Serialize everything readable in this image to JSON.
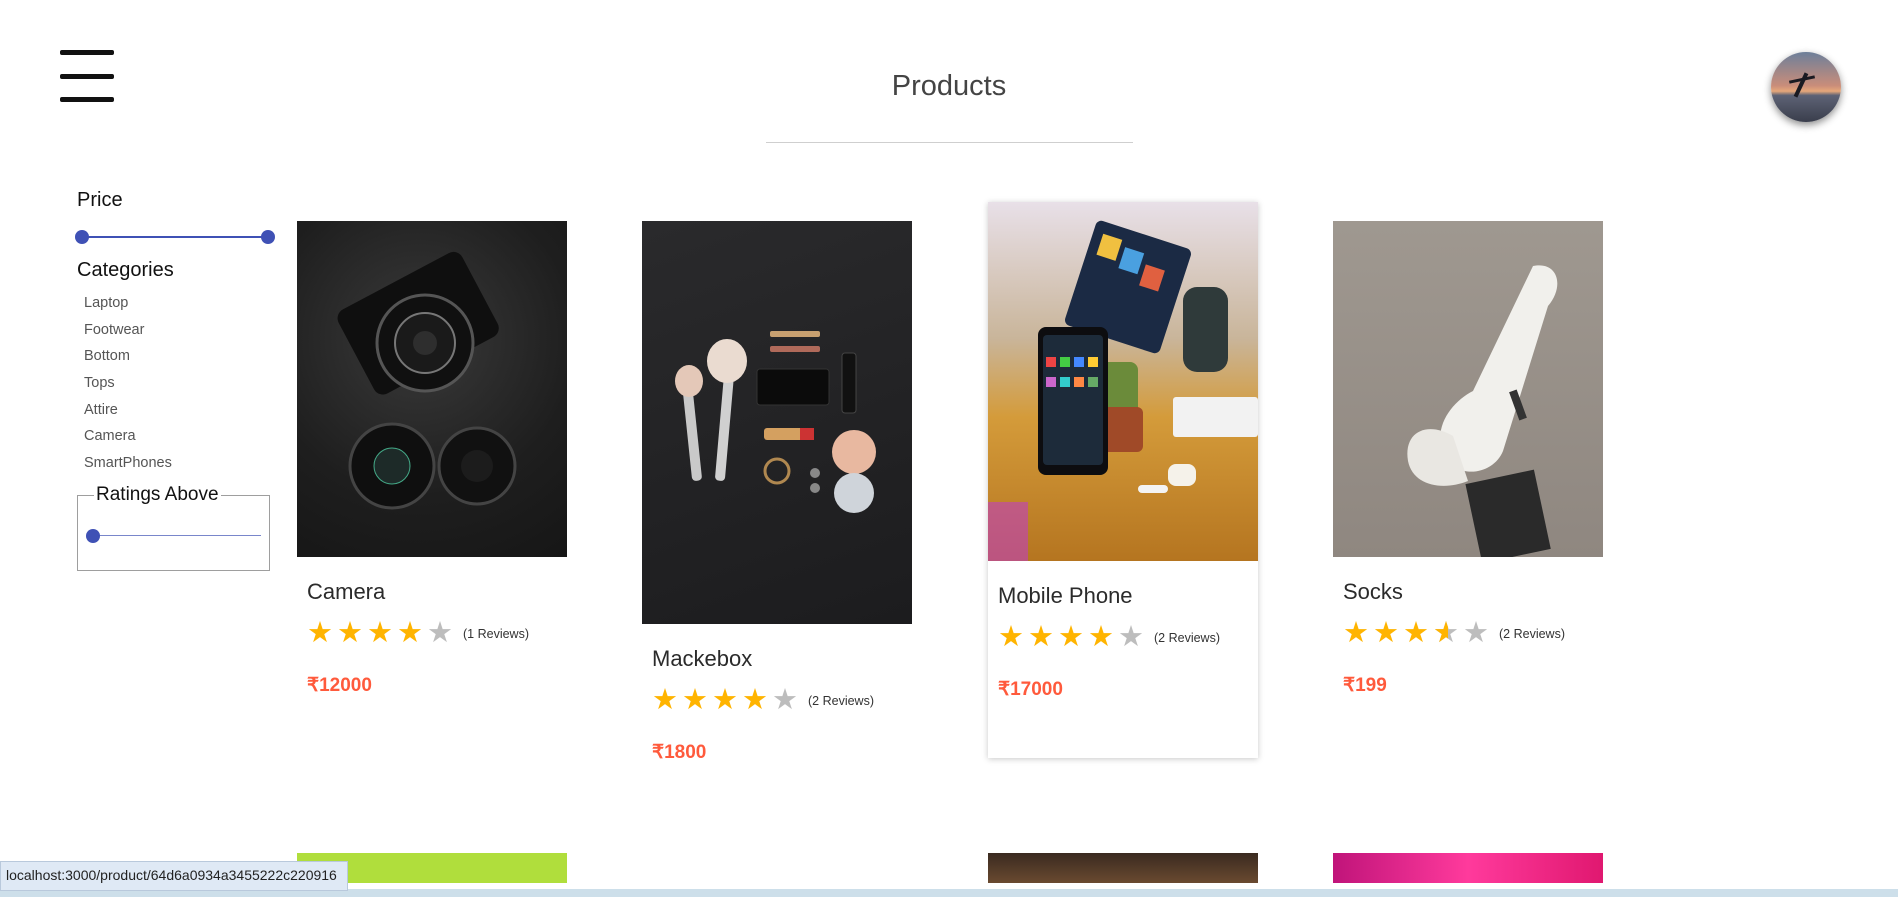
{
  "header": {
    "title": "Products",
    "menu_icon": "hamburger-icon",
    "avatar_icon": "user-avatar"
  },
  "filters": {
    "price_title": "Price",
    "price_range_fraction": [
      0,
      1
    ],
    "categories_title": "Categories",
    "categories": [
      "Laptop",
      "Footwear",
      "Bottom",
      "Tops",
      "Attire",
      "Camera",
      "SmartPhones"
    ],
    "ratings_title": "Ratings Above",
    "ratings_value": 0
  },
  "products": [
    {
      "name": "Camera",
      "rating": 4,
      "reviews": "(1 Reviews)",
      "price": "₹12000"
    },
    {
      "name": "Mackebox",
      "rating": 4,
      "reviews": "(2 Reviews)",
      "price": "₹1800"
    },
    {
      "name": "Mobile Phone",
      "rating": 4,
      "reviews": "(2 Reviews)",
      "price": "₹17000"
    },
    {
      "name": "Socks",
      "rating": 3.5,
      "reviews": "(2 Reviews)",
      "price": "₹199"
    }
  ],
  "status_bar": {
    "url": "localhost:3000/product/64d6a0934a3455222c220916"
  },
  "colors": {
    "accent": "#3f51b5",
    "star": "#ffb400",
    "price": "#ff5a3c"
  }
}
